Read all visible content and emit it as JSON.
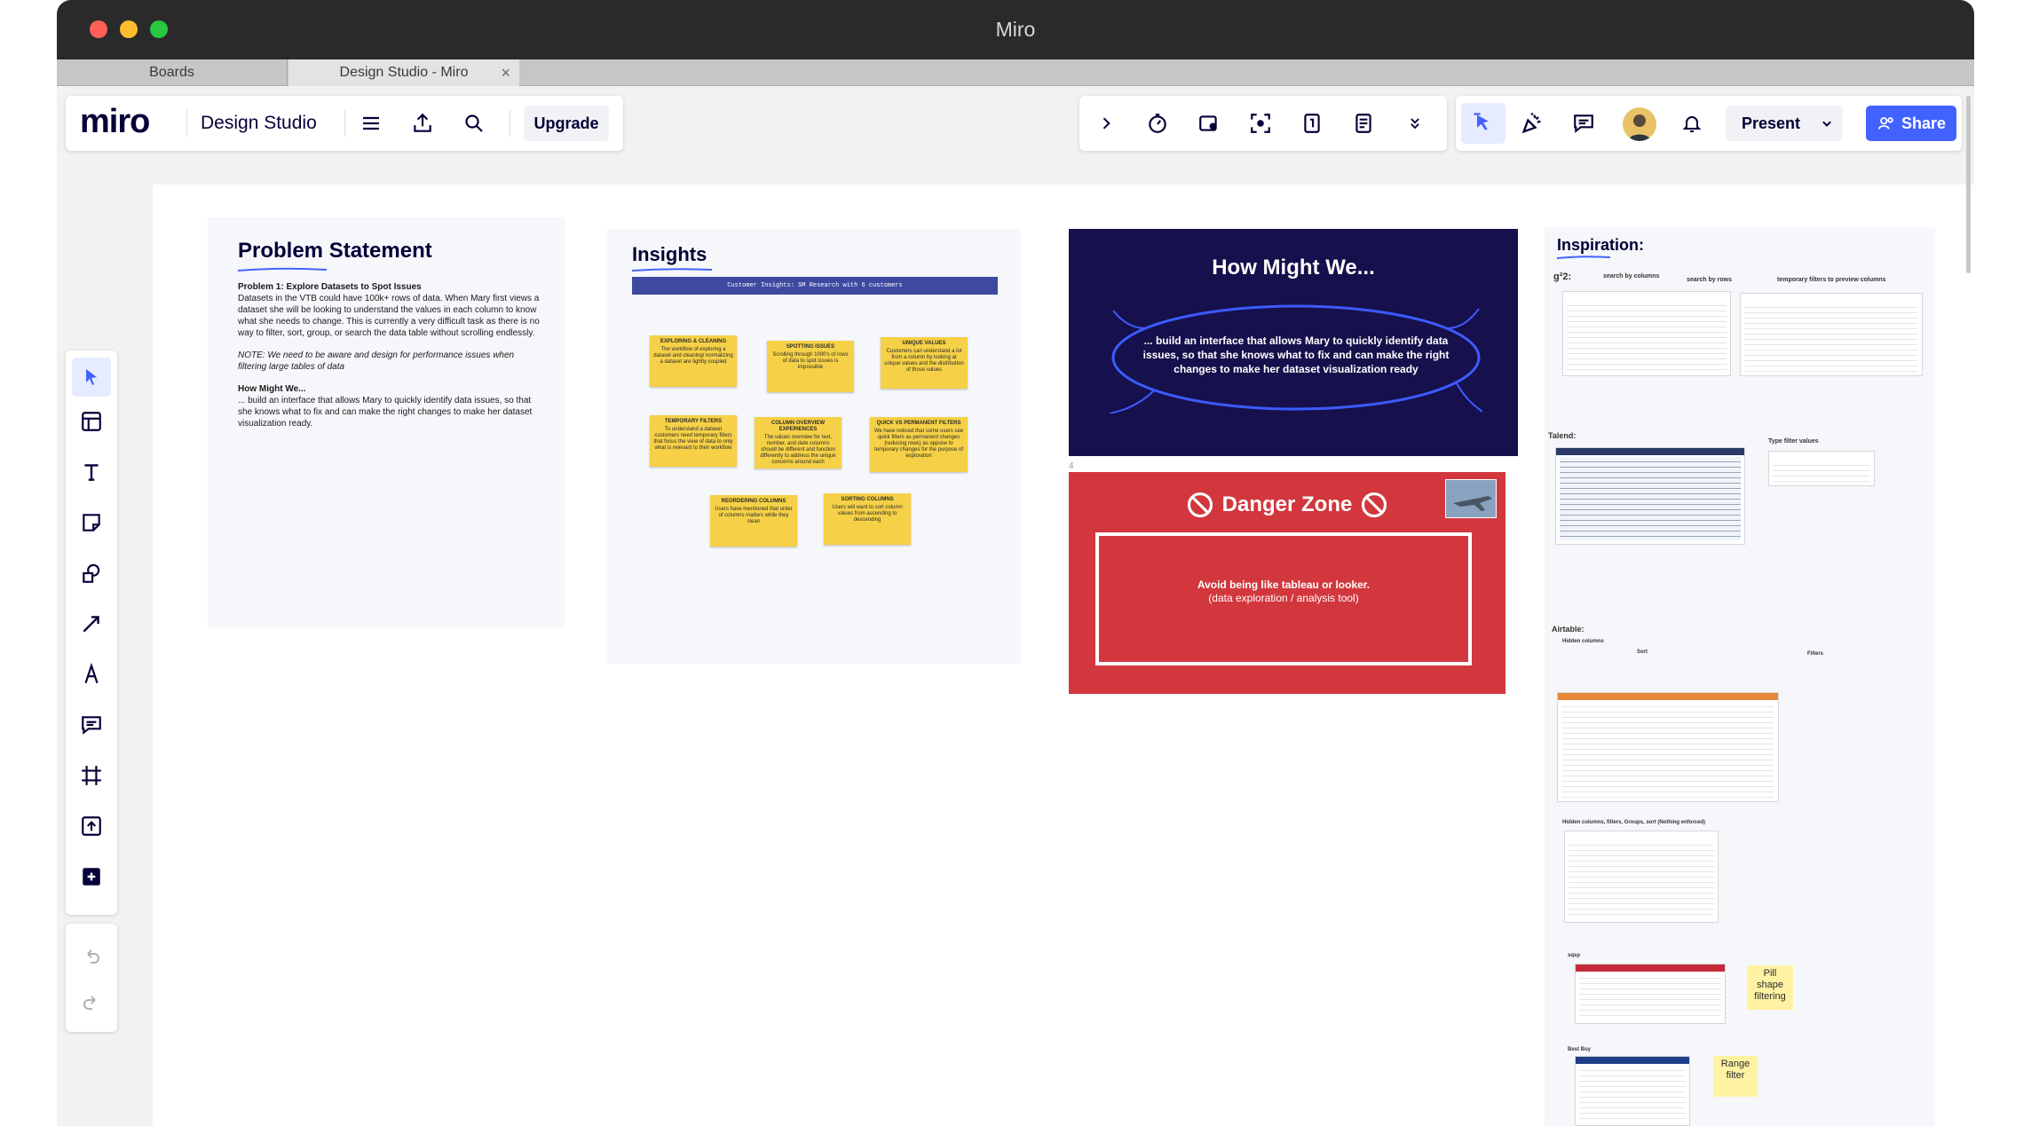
{
  "window": {
    "title": "Miro"
  },
  "tabs": [
    {
      "label": "Boards"
    },
    {
      "label": "Design Studio - Miro"
    }
  ],
  "toolbar": {
    "logo": "miro",
    "board_name": "Design Studio",
    "upgrade_label": "Upgrade",
    "present_label": "Present",
    "share_label": "Share"
  },
  "problem": {
    "title": "Problem Statement",
    "p1_heading": "Problem 1: Explore Datasets to Spot Issues",
    "p1_body": "Datasets in the VTB could have 100k+ rows of data. When Mary first views a dataset she will be looking to understand the values in each column to know what she needs to change. This is currently a very difficult task as there is no way to filter, sort, group, or search the data table without scrolling endlessly.",
    "note": "NOTE: We need to be aware and design for performance issues when filtering large tables of data",
    "hmw_heading": "How Might We...",
    "hmw_body": "... build an interface that allows Mary to quickly identify data issues, so that she knows what to fix and can make the right changes to make her dataset visualization ready."
  },
  "insights": {
    "title": "Insights",
    "banner": "Customer Insights: SM Research with 6 customers",
    "stickies": [
      {
        "title": "EXPLORING & CLEANING",
        "body": "The workflow of exploring a dataset and cleaning/ normalizing a dataset are tightly coupled"
      },
      {
        "title": "SPOTTING ISSUES",
        "body": "Scrolling through 1000's of rows of data to spot issues is impossible"
      },
      {
        "title": "UNIQUE VALUES",
        "body": "Customers can understand a lot from a column by looking at unique values and the distribution of those values"
      },
      {
        "title": "TEMPORARY FILTERS",
        "body": "To understand a dataset customers need temporary filters that focus the view of data to only what is relevant to their workflow"
      },
      {
        "title": "COLUMN OVERVIEW EXPERIENCES",
        "body": "The values overview for text, number, and date columns should be different and function differently to address the unique concerns around each"
      },
      {
        "title": "QUICK VS PERMANENT FILTERS",
        "body": "We have noticed that some users see quick filters as permanent changes (reducing rows) as oppose to temporary changes for the purpose of exploration"
      },
      {
        "title": "REORDERING COLUMNS",
        "body": "Users have mentioned that order of columns matters while they clean"
      },
      {
        "title": "SORTING COLUMNS",
        "body": "Users will want to sort column values from ascending to descending"
      }
    ]
  },
  "hmw": {
    "title": "How Might We...",
    "body": "... build an interface that allows Mary to quickly identify data issues, so that she knows what to fix and can make the right changes to make her dataset visualization ready",
    "frame_number": "4"
  },
  "danger": {
    "title": "Danger Zone",
    "line1": "Avoid being like tableau or looker.",
    "line2": "(data exploration / analysis tool)"
  },
  "inspiration": {
    "title": "Inspiration:",
    "labels": {
      "g2": "g²2:",
      "search_cols": "search by columns",
      "search_rows": "search by rows",
      "temp_filters": "temporary filters to preview columns",
      "talend": "Talend:",
      "type_filter": "Type filter values",
      "airtable": "Airtable:",
      "hidden_cols": "Hidden columns",
      "sort": "Sort",
      "filters": "Filters",
      "hidden_combo": "Hidden columns, filters, Groups, sort (Nothing enforced)",
      "sqsp": "sqsp",
      "best_buy": "Best Buy"
    },
    "pill_note": "Pill shape filtering",
    "range_note": "Range filter"
  }
}
